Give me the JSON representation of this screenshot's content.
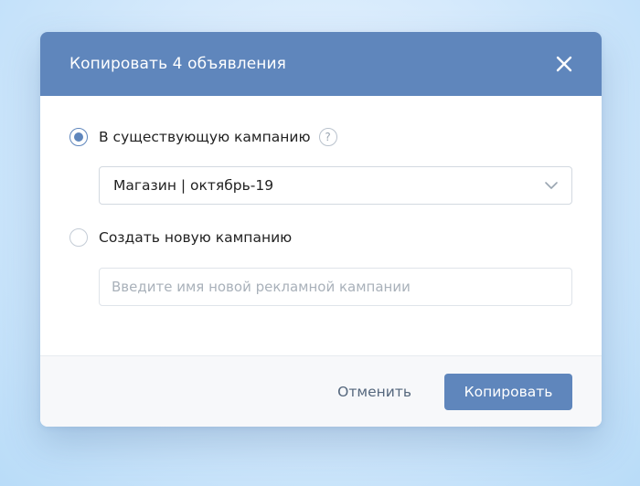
{
  "dialog": {
    "title": "Копировать 4 объявления",
    "close_icon": "close-icon"
  },
  "options": {
    "existing": {
      "label": "В существующую кампанию",
      "checked": true,
      "help_icon": "question-mark-icon",
      "help_glyph": "?"
    },
    "new": {
      "label": "Создать новую кампанию",
      "checked": false
    }
  },
  "campaign_select": {
    "value": "Магазин | октябрь-19",
    "icon": "chevron-down-icon"
  },
  "new_campaign_input": {
    "value": "",
    "placeholder": "Введите имя новой рекламной кампании"
  },
  "footer": {
    "cancel_label": "Отменить",
    "submit_label": "Копировать"
  },
  "colors": {
    "accent": "#5f86bc",
    "header_bg": "#5f86bc",
    "footer_bg": "#f7f8fa",
    "text": "#222222",
    "muted_text": "#55677d",
    "placeholder": "#a9b1ba"
  }
}
